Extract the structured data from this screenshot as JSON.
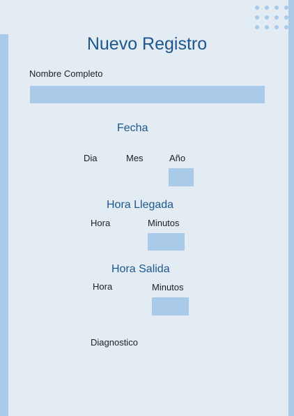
{
  "form": {
    "title": "Nuevo Registro",
    "nombre": {
      "label": "Nombre Completo",
      "value": ""
    },
    "fecha": {
      "heading": "Fecha",
      "dia_label": "Dia",
      "mes_label": "Mes",
      "anio_label": "Año",
      "anio_value": ""
    },
    "hora_llegada": {
      "heading": "Hora Llegada",
      "hora_label": "Hora",
      "minutos_label": "Minutos",
      "minutos_value": ""
    },
    "hora_salida": {
      "heading": "Hora Salida",
      "hora_label": "Hora",
      "minutos_label": "Minutos",
      "minutos_value": ""
    },
    "diagnostico": {
      "label": "Diagnostico"
    }
  },
  "colors": {
    "background": "#e3ebf3",
    "accent": "#a9cbe9",
    "heading": "#1d578d",
    "text": "#1b1f24"
  },
  "icons": [
    "dot-grid-decoration-icon"
  ]
}
